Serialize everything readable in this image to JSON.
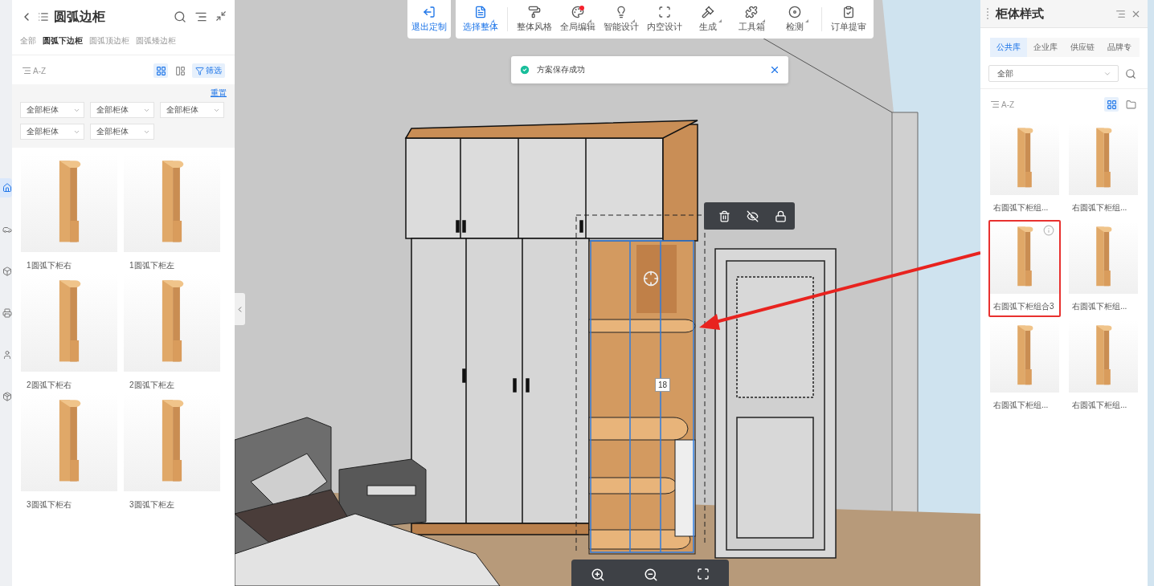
{
  "rail": [
    {
      "selected": true
    },
    {
      "selected": false
    },
    {
      "selected": false
    },
    {
      "selected": false
    },
    {
      "selected": false
    },
    {
      "selected": false
    }
  ],
  "left_panel": {
    "title": "圆弧边柜",
    "tabs": [
      {
        "label": "全部",
        "selected": false
      },
      {
        "label": "圆弧下边柜",
        "selected": true
      },
      {
        "label": "圆弧顶边柜",
        "selected": false
      },
      {
        "label": "圆弧矮边柜",
        "selected": false
      }
    ],
    "sort_label": "A-Z",
    "views": [
      {
        "selected": true
      },
      {
        "selected": false
      }
    ],
    "filter_button": "筛选",
    "reset_link": "重置",
    "filters": [
      "全部柜体",
      "全部柜体",
      "全部柜体",
      "全部柜体",
      "全部柜体"
    ],
    "items": [
      {
        "name": "1圆弧下柜右"
      },
      {
        "name": "1圆弧下柜左"
      },
      {
        "name": "2圆弧下柜右"
      },
      {
        "name": "2圆弧下柜左"
      },
      {
        "name": "3圆弧下柜右"
      },
      {
        "name": "3圆弧下柜左"
      }
    ]
  },
  "toolbar": {
    "exit_button": "退出定制",
    "tools": [
      {
        "label": "选择整体",
        "selected": true,
        "has_menu": true,
        "notification": false
      },
      {
        "label": "整体风格",
        "selected": false,
        "has_menu": false,
        "notification": false
      },
      {
        "label": "全局编辑",
        "selected": false,
        "has_menu": true,
        "notification": true
      },
      {
        "label": "智能设计",
        "selected": false,
        "has_menu": true,
        "notification": false
      },
      {
        "label": "内空设计",
        "selected": false,
        "has_menu": false,
        "notification": false
      },
      {
        "label": "生成",
        "selected": false,
        "has_menu": true,
        "notification": false
      },
      {
        "label": "工具箱",
        "selected": false,
        "has_menu": true,
        "notification": false
      },
      {
        "label": "检测",
        "selected": false,
        "has_menu": true,
        "notification": false
      },
      {
        "label": "订单提审",
        "selected": false,
        "has_menu": false,
        "notification": false
      }
    ]
  },
  "toast": {
    "message": "方案保存成功"
  },
  "dimension_label": "18",
  "right_panel": {
    "title": "柜体样式",
    "tabs": [
      {
        "label": "公共库",
        "selected": true
      },
      {
        "label": "企业库",
        "selected": false
      },
      {
        "label": "供应链",
        "selected": false
      },
      {
        "label": "品牌专",
        "selected": false
      }
    ],
    "category_select": "全部",
    "sort_label": "A-Z",
    "views": [
      {
        "selected": true
      },
      {
        "selected": false
      }
    ],
    "items": [
      {
        "name": "右圆弧下柜组...",
        "selected": false
      },
      {
        "name": "右圆弧下柜组...",
        "selected": false
      },
      {
        "name": "右圆弧下柜组合3",
        "selected": true
      },
      {
        "name": "右圆弧下柜组...",
        "selected": false
      },
      {
        "name": "右圆弧下柜组...",
        "selected": false
      },
      {
        "name": "右圆弧下柜组...",
        "selected": false
      }
    ]
  }
}
